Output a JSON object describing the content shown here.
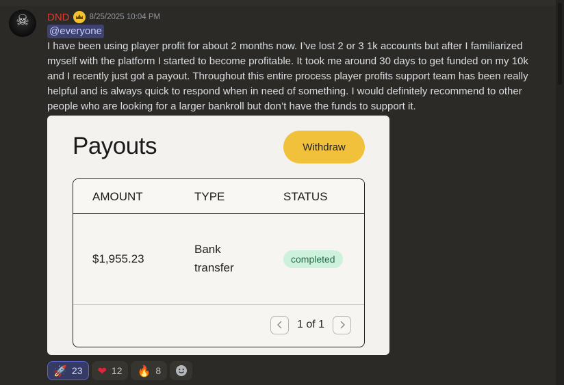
{
  "message": {
    "author": "DND",
    "timestamp": "8/25/2025 10:04 PM",
    "mention": "@everyone",
    "text": "I have been using player profit for about 2 months now. I’ve lost 2 or 3 1k accounts but after I familiarized myself with the platform I started to become profitable. It took me around 30 days to get funded on my 10k and I recently just got a payout. Throughout this entire process player profits support team has been really helpful and is always quick to respond when in need of something. I would definitely recommend to other people who are looking for a larger bankroll but don’t have the funds to support it."
  },
  "payout_card": {
    "title": "Payouts",
    "withdraw_label": "Withdraw",
    "columns": [
      "AMOUNT",
      "TYPE",
      "STATUS"
    ],
    "rows": [
      {
        "amount": "$1,955.23",
        "type_line1": "Bank",
        "type_line2": "transfer",
        "status": "completed"
      }
    ],
    "pagination": "1 of 1"
  },
  "reactions": [
    {
      "emoji": "rocket",
      "glyph": "🚀",
      "count": "23",
      "active": true
    },
    {
      "emoji": "heart",
      "glyph": "❤",
      "count": "12",
      "active": false
    },
    {
      "emoji": "fire",
      "glyph": "🔥",
      "count": "8",
      "active": false
    }
  ],
  "colors": {
    "background": "#2b2a27",
    "username": "#e23a2a",
    "mention_bg": "#3d4270",
    "withdraw_button": "#f2c13b",
    "status_pill": "#cdf1dd"
  },
  "icons": {
    "author_badge": "crown-icon",
    "add_reaction": "smiley-icon",
    "pager_prev": "chevron-left-icon",
    "pager_next": "chevron-right-icon"
  }
}
